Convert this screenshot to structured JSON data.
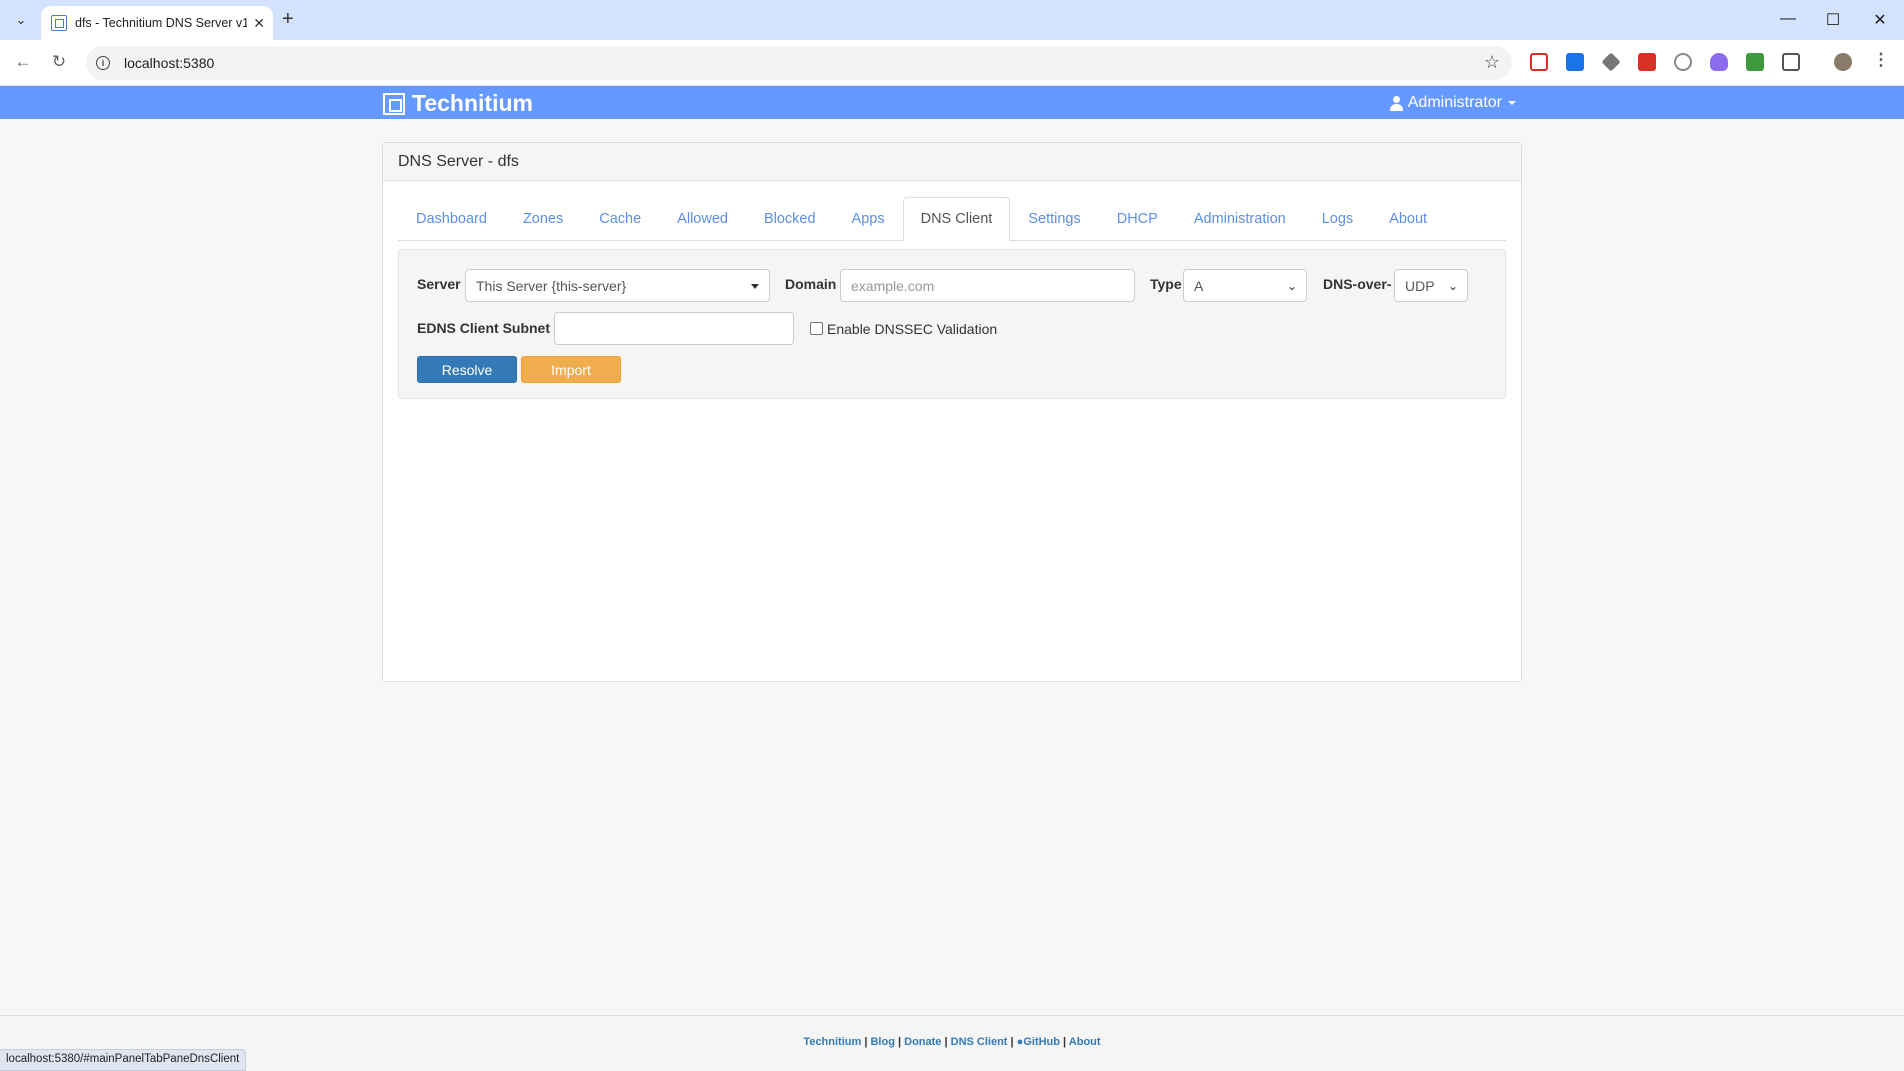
{
  "browser": {
    "tab_title": "dfs - Technitium DNS Server v1",
    "url": "localhost:5380",
    "status_url": "localhost:5380/#mainPanelTabPaneDnsClient"
  },
  "header": {
    "brand": "Technitium",
    "user": "Administrator"
  },
  "panel": {
    "title": "DNS Server - dfs"
  },
  "tabs": [
    {
      "label": "Dashboard"
    },
    {
      "label": "Zones"
    },
    {
      "label": "Cache"
    },
    {
      "label": "Allowed"
    },
    {
      "label": "Blocked"
    },
    {
      "label": "Apps"
    },
    {
      "label": "DNS Client"
    },
    {
      "label": "Settings"
    },
    {
      "label": "DHCP"
    },
    {
      "label": "Administration"
    },
    {
      "label": "Logs"
    },
    {
      "label": "About"
    }
  ],
  "active_tab": "DNS Client",
  "form": {
    "server_label": "Server",
    "server_value": "This Server {this-server}",
    "domain_label": "Domain",
    "domain_placeholder": "example.com",
    "type_label": "Type",
    "type_value": "A",
    "protocol_label": "DNS-over-",
    "protocol_value": "UDP",
    "edns_label": "EDNS Client Subnet",
    "edns_value": "",
    "dnssec_label": "Enable DNSSEC Validation",
    "dnssec_checked": false,
    "resolve_label": "Resolve",
    "import_label": "Import"
  },
  "footer": {
    "links": [
      "Technitium",
      "Blog",
      "Donate",
      "DNS Client",
      "GitHub",
      "About"
    ]
  },
  "colors": {
    "header_bg": "#6699ff",
    "primary": "#337ab7",
    "warning": "#f0ad4e",
    "link": "#5b8fe6"
  }
}
